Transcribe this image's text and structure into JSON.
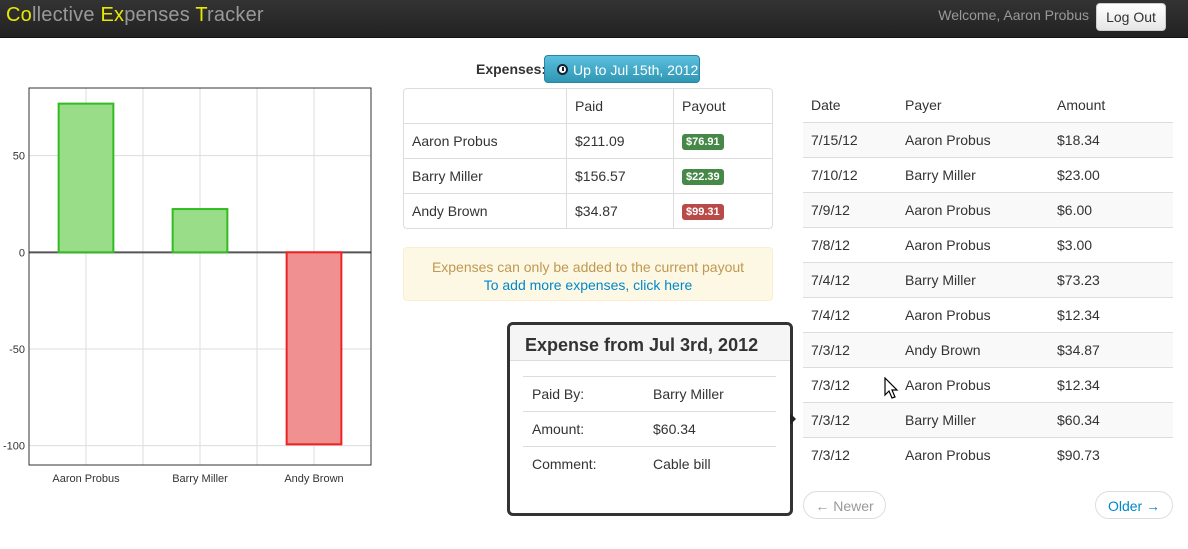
{
  "app": {
    "title_parts": [
      {
        "text": "Co",
        "highlight": true
      },
      {
        "text": "llective ",
        "highlight": false
      },
      {
        "text": "Ex",
        "highlight": true
      },
      {
        "text": "penses ",
        "highlight": false
      },
      {
        "text": "T",
        "highlight": true
      },
      {
        "text": "racker",
        "highlight": false
      }
    ],
    "welcome": "Welcome, Aaron Probus",
    "logout_label": "Log Out"
  },
  "expenses_header": {
    "label": "Expenses:",
    "period_button": "Up to Jul 15th, 2012"
  },
  "chart_data": {
    "type": "bar",
    "categories": [
      "Aaron Probus",
      "Barry Miller",
      "Andy Brown"
    ],
    "values": [
      76.91,
      22.39,
      -99.31
    ],
    "ylim": [
      -110,
      85
    ],
    "yticks": [
      50,
      0,
      -50,
      -100
    ],
    "grid": true,
    "colors": {
      "positive_fill": "#99dd88",
      "positive_stroke": "#33bb22",
      "negative_fill": "#f09090",
      "negative_stroke": "#ee2222"
    }
  },
  "summary": {
    "headers": [
      "",
      "Paid",
      "Payout"
    ],
    "rows": [
      {
        "name": "Aaron Probus",
        "paid": "$211.09",
        "payout": "$76.91",
        "status": "positive"
      },
      {
        "name": "Barry Miller",
        "paid": "$156.57",
        "payout": "$22.39",
        "status": "positive"
      },
      {
        "name": "Andy Brown",
        "paid": "$34.87",
        "payout": "$99.31",
        "status": "negative"
      }
    ]
  },
  "alert": {
    "message": "Expenses can only be added to the current payout",
    "link_text": "To add more expenses, click here"
  },
  "popover": {
    "title": "Expense from Jul 3rd, 2012",
    "fields": [
      {
        "label": "Paid By:",
        "value": "Barry Miller"
      },
      {
        "label": "Amount:",
        "value": "$60.34"
      },
      {
        "label": "Comment:",
        "value": "Cable bill"
      }
    ]
  },
  "expense_list": {
    "headers": [
      "Date",
      "Payer",
      "Amount"
    ],
    "rows": [
      {
        "date": "7/15/12",
        "payer": "Aaron Probus",
        "amount": "$18.34"
      },
      {
        "date": "7/10/12",
        "payer": "Barry Miller",
        "amount": "$23.00"
      },
      {
        "date": "7/9/12",
        "payer": "Aaron Probus",
        "amount": "$6.00"
      },
      {
        "date": "7/8/12",
        "payer": "Aaron Probus",
        "amount": "$3.00"
      },
      {
        "date": "7/4/12",
        "payer": "Barry Miller",
        "amount": "$73.23"
      },
      {
        "date": "7/4/12",
        "payer": "Aaron Probus",
        "amount": "$12.34"
      },
      {
        "date": "7/3/12",
        "payer": "Andy Brown",
        "amount": "$34.87"
      },
      {
        "date": "7/3/12",
        "payer": "Aaron Probus",
        "amount": "$12.34"
      },
      {
        "date": "7/3/12",
        "payer": "Barry Miller",
        "amount": "$60.34"
      },
      {
        "date": "7/3/12",
        "payer": "Aaron Probus",
        "amount": "$90.73"
      }
    ]
  },
  "pager": {
    "newer_label": "← Newer",
    "older_label": "Older →"
  },
  "colors": {
    "brand_highlight": "#e8e800",
    "info_button": "#2f96b4",
    "badge_positive": "#468847",
    "badge_negative": "#b94a48",
    "link": "#0088cc"
  },
  "icons": {
    "period_button": "clock-icon",
    "cursor": "mouse-pointer-icon"
  }
}
